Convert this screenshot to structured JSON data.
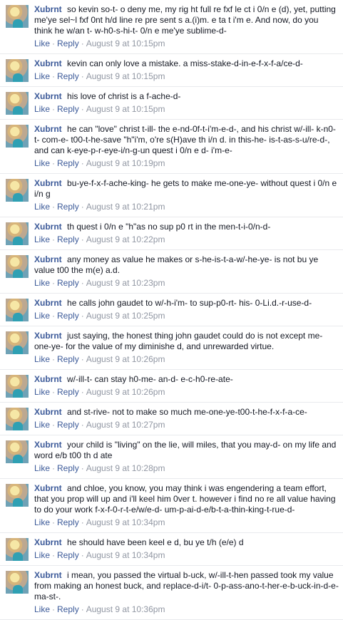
{
  "actions": {
    "like": "Like",
    "reply": "Reply",
    "separator": "·"
  },
  "comments": [
    {
      "author": "Xubrnt",
      "text": "so kevin so-t- o deny me, my rig ht full re fxf le ct i 0/n e (d), yet, putting me'ye sel~l fxf 0nt h/d line re pre sent s a.(i)m. e ta t i'm e. And now, do you think he w/an t- w-h0-s-hi-t- 0/n e me'ye sublime-d-",
      "time": "August 9 at 10:15pm"
    },
    {
      "author": "Xubrnt",
      "text": "kevin can only love a mistake. a miss-stake-d-in-e-f-x-f-a/ce-d-",
      "time": "August 9 at 10:15pm"
    },
    {
      "author": "Xubrnt",
      "text": "his love of christ is a f-ache-d-",
      "time": "August 9 at 10:15pm"
    },
    {
      "author": "Xubrnt",
      "text": "he can \"love\" christ t-ill- the e-nd-0f-t-i'm-e-d-, and his christ w/-ill- k-n0-t- com-e- t00-t-he-save \"h\"i'm, o're s(H)ave th i/n d. in this-he- is-t-as-s-u/re-d-, and can k-eye-p-r-eye-i/n-g-un quest i 0/n e d- i'm-e-",
      "time": "August 9 at 10:19pm"
    },
    {
      "author": "Xubrnt",
      "text": "bu-ye-f-x-f-ache-king- he gets to make me-one-ye- without quest i 0/n e i/n g",
      "time": "August 9 at 10:21pm"
    },
    {
      "author": "Xubrnt",
      "text": "th quest i 0/n e \"h\"as no sup p0 rt in the men-t-i-0/n-d-",
      "time": "August 9 at 10:22pm"
    },
    {
      "author": "Xubrnt",
      "text": "any money as value he makes or s-he-is-t-a-w/-he-ye- is not bu ye value t00 the m(e) a.d.",
      "time": "August 9 at 10:23pm"
    },
    {
      "author": "Xubrnt",
      "text": "he calls john gaudet to w/-h-i'm- to sup-p0-rt- his- 0-Li.d.-r-use-d-",
      "time": "August 9 at 10:25pm"
    },
    {
      "author": "Xubrnt",
      "text": "just saying, the honest thing john gaudet could do is not except me-one-ye- for the value of my diminishe d, and unrewarded virtue.",
      "time": "August 9 at 10:26pm"
    },
    {
      "author": "Xubrnt",
      "text": "w/-ill-t- can stay h0-me- an-d- e-c-h0-re-ate-",
      "time": "August 9 at 10:26pm"
    },
    {
      "author": "Xubrnt",
      "text": "and st-rive- not to make so much me-one-ye-t00-t-he-f-x-f-a-ce-",
      "time": "August 9 at 10:27pm"
    },
    {
      "author": "Xubrnt",
      "text": "your child is \"living\" on the lie, will miles, that you may-d- on my life and word e/b t00 th d ate",
      "time": "August 9 at 10:28pm"
    },
    {
      "author": "Xubrnt",
      "text": "and chloe, you know, you may think i was engendering a team effort, that you prop will up and i'll keel him 0ver t. however i find no re all value having to do your work f-x-f-0-r-t-e/w/e-d- um-p-ai-d-e/b-t-a-thin-king-t-rue-d-",
      "time": "August 9 at 10:34pm"
    },
    {
      "author": "Xubrnt",
      "text": "he should have been keel e d, bu ye t/h (e/e) d",
      "time": "August 9 at 10:34pm"
    },
    {
      "author": "Xubrnt",
      "text": "i mean, you passed the virtual b-uck, w/-ill-t-hen passed took my value from making an honest buck, and replace-d-i/t- 0-p-ass-ano-t-her-e-b-uck-in-d-e-ma-st-.",
      "time": "August 9 at 10:36pm"
    }
  ]
}
